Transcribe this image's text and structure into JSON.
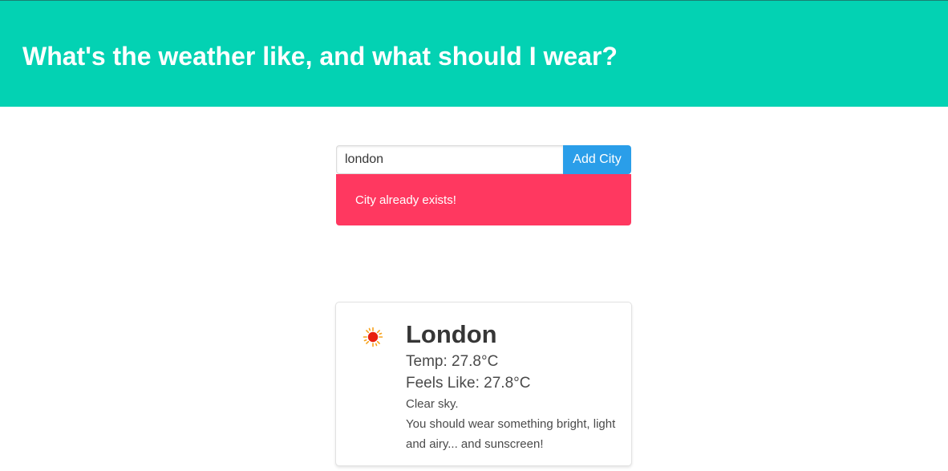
{
  "header": {
    "title": "What's the weather like, and what should I wear?",
    "background_color": "#03d2b3"
  },
  "search": {
    "value": "london",
    "button_label": "Add City",
    "button_color": "#2a9ee9"
  },
  "notification": {
    "message": "City already exists!",
    "color": "#ff3860"
  },
  "cards": [
    {
      "icon": "sun-icon",
      "city": "London",
      "temp": "Temp: 27.8°C",
      "feels_like": "Feels Like: 27.8°C",
      "description": "Clear sky.",
      "advice": "You should wear something bright, light and airy... and sunscreen!"
    }
  ]
}
